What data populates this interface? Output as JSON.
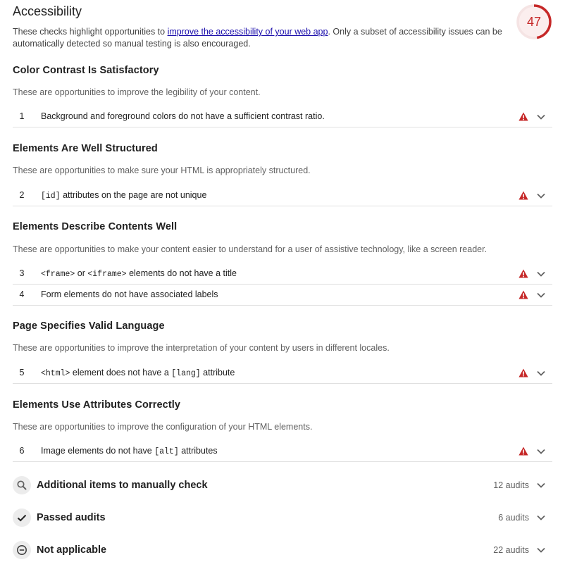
{
  "header": {
    "title": "Accessibility",
    "intro_before": "These checks highlight opportunities to ",
    "intro_link": "improve the accessibility of your web app",
    "intro_after": ". Only a subset of accessibility issues can be automatically detected so manual testing is also encouraged.",
    "score": "47",
    "score_fraction": 0.47,
    "score_color": "#c62828"
  },
  "groups": {
    "contrast": {
      "title": "Color Contrast Is Satisfactory",
      "description": "These are opportunities to improve the legibility of your content."
    },
    "structure": {
      "title": "Elements Are Well Structured",
      "description": "These are opportunities to make sure your HTML is appropriately structured."
    },
    "describe": {
      "title": "Elements Describe Contents Well",
      "description": "These are opportunities to make your content easier to understand for a user of assistive technology, like a screen reader."
    },
    "language": {
      "title": "Page Specifies Valid Language",
      "description": "These are opportunities to improve the interpretation of your content by users in different locales."
    },
    "attributes": {
      "title": "Elements Use Attributes Correctly",
      "description": "These are opportunities to improve the configuration of your HTML elements."
    }
  },
  "audits": {
    "a1": {
      "index": "1",
      "text": "Background and foreground colors do not have a sufficient contrast ratio."
    },
    "a2": {
      "index": "2",
      "code1": "[id]",
      "text1": " attributes on the page are not unique"
    },
    "a3": {
      "index": "3",
      "code1": "<frame>",
      "text1": " or ",
      "code2": "<iframe>",
      "text2": " elements do not have a title"
    },
    "a4": {
      "index": "4",
      "text": "Form elements do not have associated labels"
    },
    "a5": {
      "index": "5",
      "code1": "<html>",
      "text1": " element does not have a ",
      "code2": "[lang]",
      "text2": " attribute"
    },
    "a6": {
      "index": "6",
      "text1": "Image elements do not have ",
      "code1": "[alt]",
      "text2": " attributes"
    }
  },
  "clusters": {
    "manual": {
      "label": "Additional items to manually check",
      "count": "12 audits",
      "icon": "search-icon"
    },
    "passed": {
      "label": "Passed audits",
      "count": "6 audits",
      "icon": "check-icon"
    },
    "notapplicable": {
      "label": "Not applicable",
      "count": "22 audits",
      "icon": "minus-circle-icon"
    }
  },
  "colors": {
    "fail": "#c62828",
    "link": "#1a0dab"
  }
}
